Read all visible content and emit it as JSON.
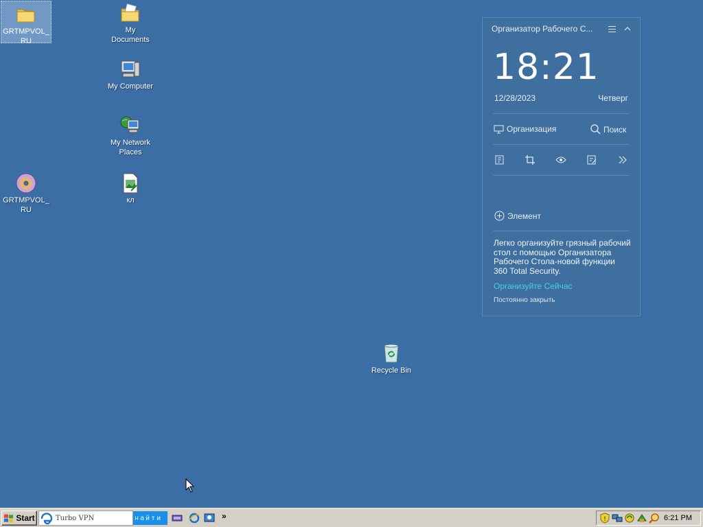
{
  "desktop": {
    "icons": [
      {
        "label": "GRTMPVOL_\nRU",
        "kind": "folder-icon"
      },
      {
        "label": "My\nDocuments",
        "kind": "my-documents-icon"
      },
      {
        "label": "My Computer",
        "kind": "my-computer-icon"
      },
      {
        "label": "My Network\nPlaces",
        "kind": "network-places-icon"
      },
      {
        "label": "GRTMPVOL_\nRU",
        "kind": "cd-drive-icon"
      },
      {
        "label": "кл",
        "kind": "image-file-icon"
      },
      {
        "label": "Recycle Bin",
        "kind": "recycle-bin-icon"
      }
    ]
  },
  "widget": {
    "title": "Организатор Рабочего С...",
    "time": "18:21",
    "date": "12/28/2023",
    "weekday": "Четверг",
    "organize_label": "Организация",
    "search_label": "Поиск",
    "add_item_label": "Элемент",
    "promo_text": "Легко организуйте грязный рабочий стол с помощью Организатора Рабочего Стола-новой функции 360 Total Security.",
    "promo_link": "Организуйте Сейчас",
    "close_forever": "Постоянно закрыть",
    "link_color": "#44d0f0"
  },
  "taskbar": {
    "start_label": "Start",
    "vpn_label": "Turbo VPN",
    "find_label": "найти",
    "overflow": "»",
    "clock": "6:21 PM"
  }
}
